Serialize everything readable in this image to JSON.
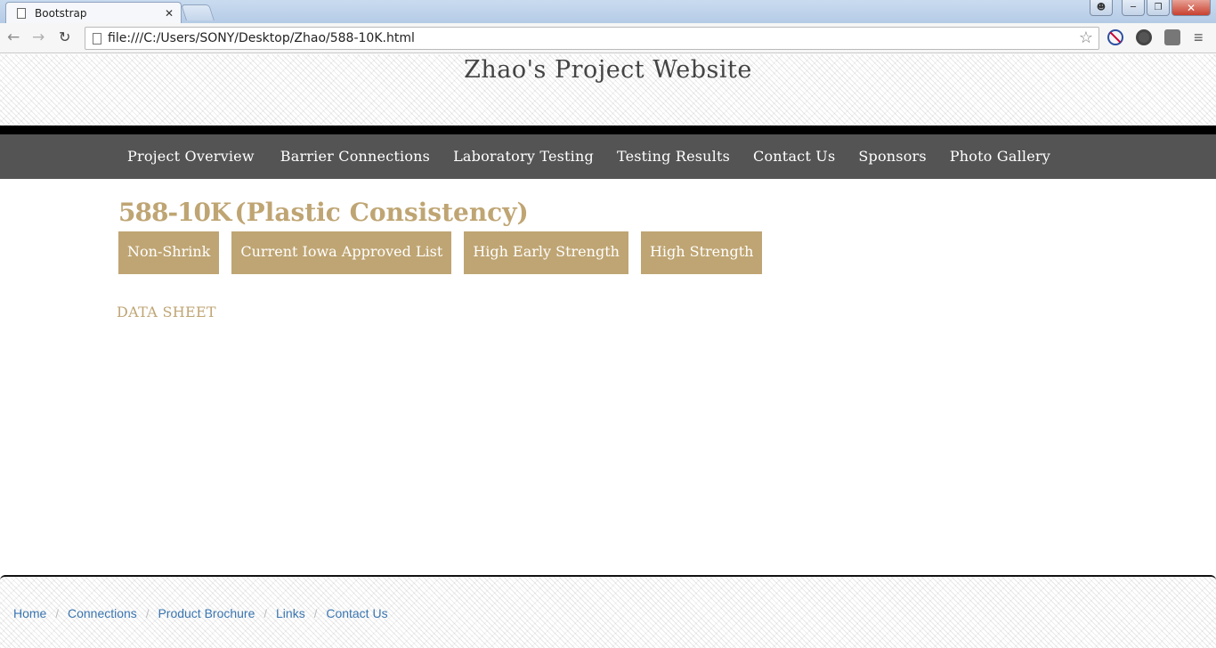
{
  "browser": {
    "tab_title": "Bootstrap",
    "tab_close": "✕",
    "url": "file:///C:/Users/SONY/Desktop/Zhao/588-10K.html"
  },
  "header": {
    "site_title": "Zhao's Project Website"
  },
  "nav": {
    "items": [
      "Project Overview",
      "Barrier Connections",
      "Laboratory Testing",
      "Testing Results",
      "Contact Us",
      "Sponsors",
      "Photo Gallery"
    ]
  },
  "product": {
    "code": "588-10K",
    "subtitle": "(Plastic Consistency)",
    "tags": [
      "Non-Shrink",
      "Current Iowa Approved List",
      "High Early Strength",
      "High Strength"
    ],
    "data_sheet_label": "DATA SHEET"
  },
  "footer": {
    "links": [
      "Home",
      "Connections",
      "Product Brochure",
      "Links",
      "Contact Us"
    ],
    "separator": "/"
  },
  "colors": {
    "accent_tan": "#bfa573",
    "nav_bg": "#545454",
    "link_blue": "#3a75b0"
  }
}
